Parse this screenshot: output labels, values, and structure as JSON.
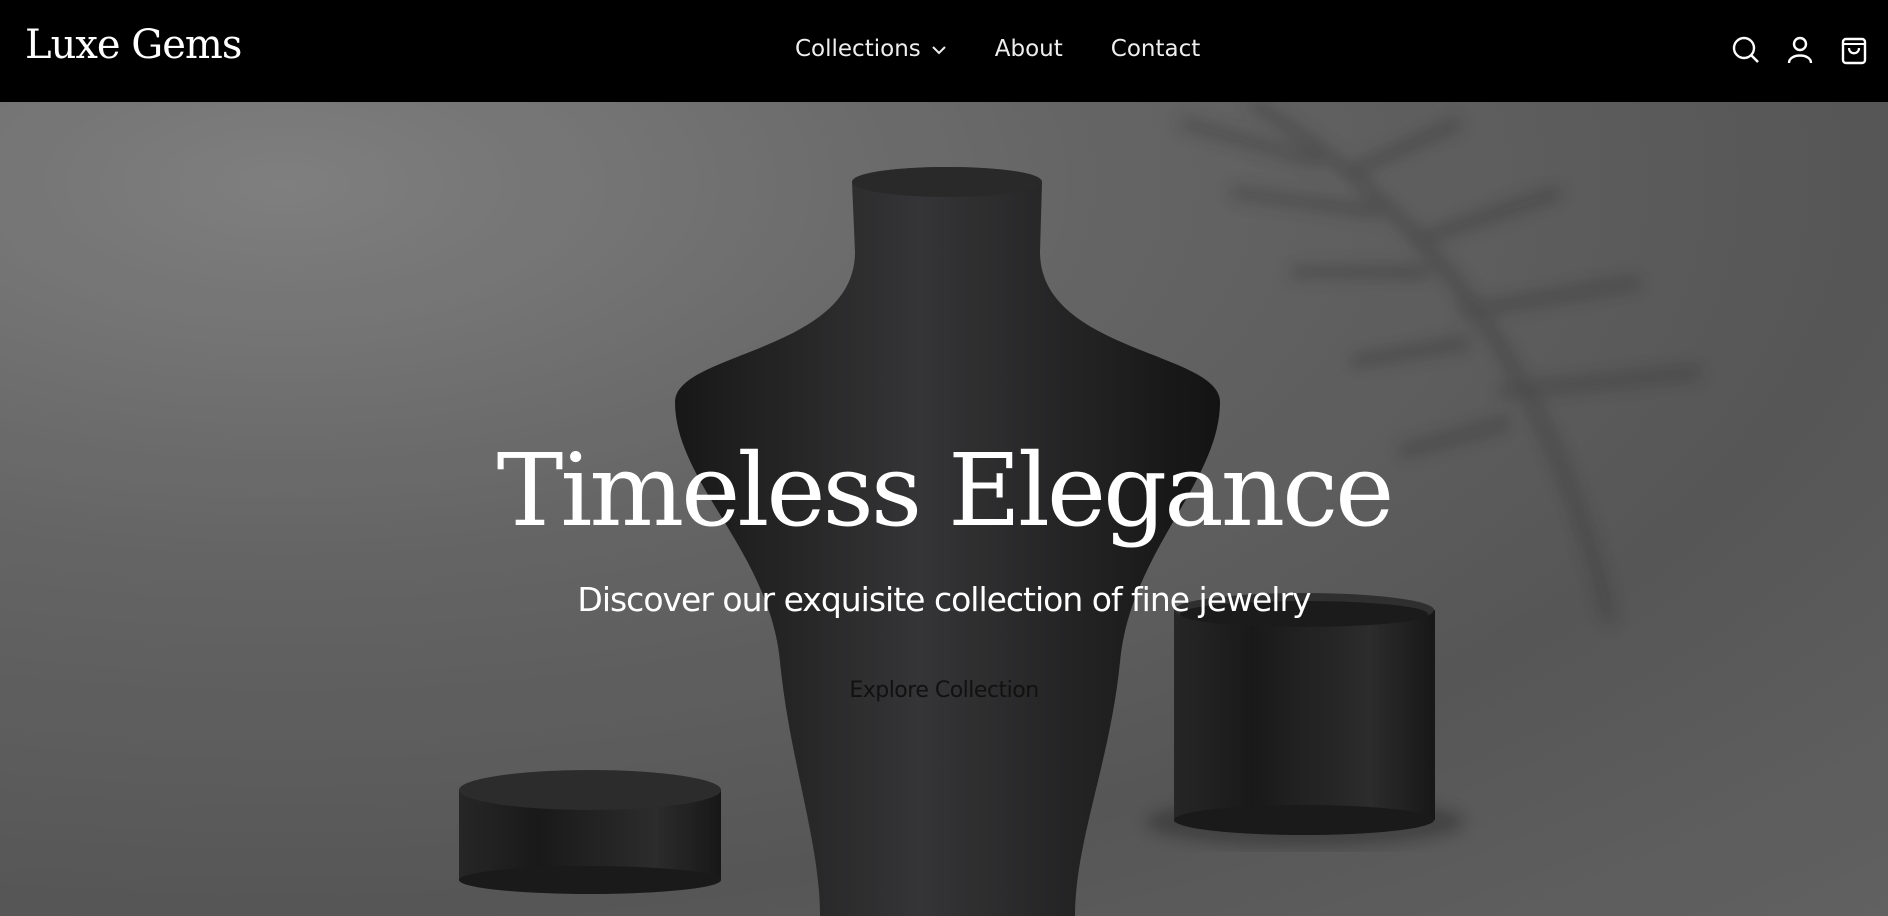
{
  "header": {
    "logo": "Luxe Gems",
    "nav": [
      {
        "label": "Collections",
        "has_dropdown": true
      },
      {
        "label": "About"
      },
      {
        "label": "Contact"
      }
    ],
    "icons": [
      "search-icon",
      "user-icon",
      "shopping-bag-icon"
    ]
  },
  "hero": {
    "title": "Timeless Elegance",
    "subtitle": "Discover our exquisite collection of fine jewelry",
    "cta_label": "Explore Collection"
  }
}
